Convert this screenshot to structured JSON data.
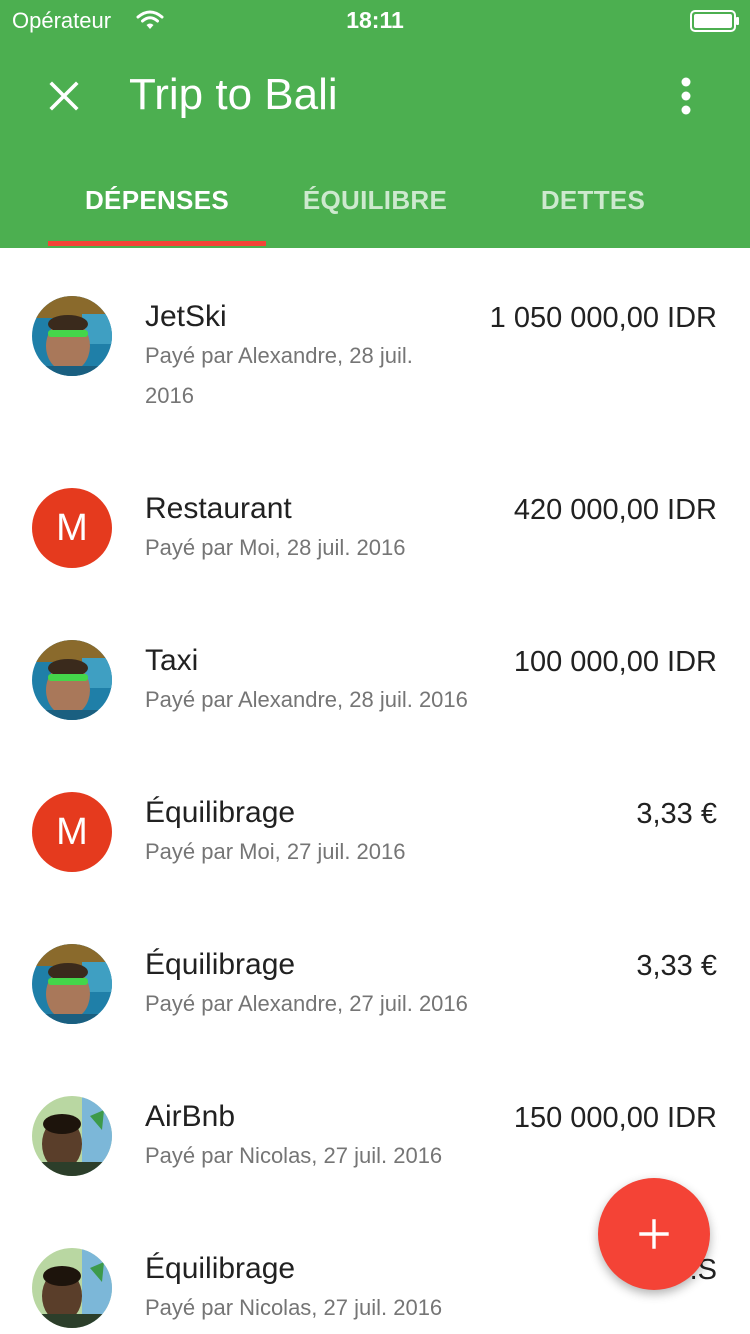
{
  "status_bar": {
    "carrier": "Opérateur",
    "time": "18:11"
  },
  "toolbar": {
    "title": "Trip to Bali",
    "close_icon": "close-icon",
    "more_icon": "more-vert-icon"
  },
  "tabs": [
    {
      "label": "DÉPENSES",
      "active": true
    },
    {
      "label": "ÉQUILIBRE",
      "active": false
    },
    {
      "label": "DETTES",
      "active": false
    }
  ],
  "expenses": [
    {
      "title": "JetSki",
      "subtitle_line1": "Payé par Alexandre, 28 juil.",
      "subtitle_line2": "2016",
      "amount": "1 050 000,00 IDR",
      "avatar": "photo-alexandre"
    },
    {
      "title": "Restaurant",
      "subtitle_line1": "Payé par Moi, 28 juil. 2016",
      "amount": "420 000,00 IDR",
      "avatar": "letter",
      "avatar_letter": "M"
    },
    {
      "title": "Taxi",
      "subtitle_line1": "Payé par Alexandre, 28 juil. 2016",
      "amount": "100 000,00 IDR",
      "avatar": "photo-alexandre"
    },
    {
      "title": "Équilibrage",
      "subtitle_line1": "Payé par Moi, 27 juil. 2016",
      "amount": "3,33 €",
      "avatar": "letter",
      "avatar_letter": "M"
    },
    {
      "title": "Équilibrage",
      "subtitle_line1": "Payé par Alexandre, 27 juil. 2016",
      "amount": "3,33 €",
      "avatar": "photo-alexandre"
    },
    {
      "title": "AirBnb",
      "subtitle_line1": "Payé par Nicolas, 27 juil. 2016",
      "amount": "150 000,00 IDR",
      "avatar": "photo-nicolas"
    },
    {
      "title": "Équilibrage",
      "subtitle_line1": "Payé par Nicolas, 27 juil. 2016",
      "amount": "16,...S",
      "avatar": "photo-nicolas"
    }
  ],
  "fab": {
    "icon": "plus-icon"
  },
  "colors": {
    "primary": "#4caf50",
    "accent": "#f44336",
    "avatar_letter_bg": "#e53a1e"
  }
}
